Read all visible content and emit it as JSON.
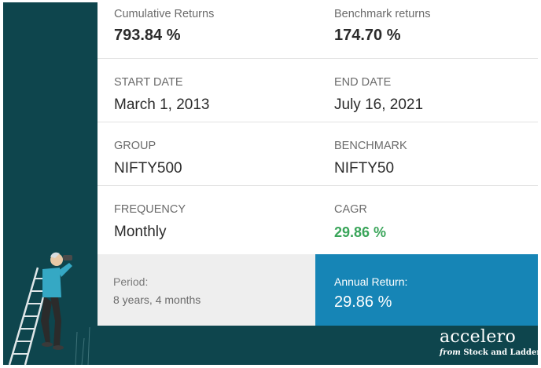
{
  "stats": {
    "cumulative_returns": {
      "label": "Cumulative Returns",
      "value": "793.84 %"
    },
    "benchmark_returns": {
      "label": "Benchmark returns",
      "value": "174.70 %"
    },
    "start_date": {
      "label": "START DATE",
      "value": "March 1, 2013"
    },
    "end_date": {
      "label": "END DATE",
      "value": "July 16, 2021"
    },
    "group": {
      "label": "GROUP",
      "value": "NIFTY500"
    },
    "benchmark": {
      "label": "BENCHMARK",
      "value": "NIFTY50"
    },
    "frequency": {
      "label": "FREQUENCY",
      "value": "Monthly"
    },
    "cagr": {
      "label": "CAGR",
      "value": "29.86 %"
    }
  },
  "summary": {
    "period_label": "Period:",
    "period_value": "8 years, 4 months",
    "annual_return_label": "Annual Return:",
    "annual_return_value": "29.86 %"
  },
  "brand": {
    "name": "accelero",
    "tagline_from": "from",
    "tagline_company": "Stock and Ladder"
  },
  "colors": {
    "background": "#0e454d",
    "accent_blue": "#1685b6",
    "positive_green": "#3aa55a",
    "period_bg": "#eeeeee"
  },
  "icons": [
    "person-with-binoculars-on-ladder-illustration",
    "accelero-logo"
  ]
}
